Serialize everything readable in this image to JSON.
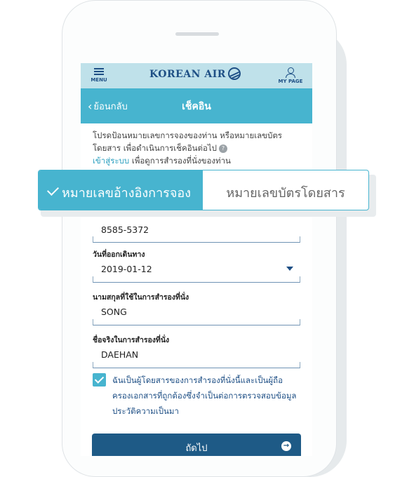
{
  "header": {
    "menu_label": "MENU",
    "logo_text": "KOREAN AIR",
    "mypage_label": "MY PAGE"
  },
  "subheader": {
    "back_label": "ย้อนกลับ",
    "title": "เช็คอิน"
  },
  "intro": {
    "line1": "โปรดป้อนหมายเลขการจองของท่าน หรือหมายเลขบัตร",
    "line2": "โดยสาร เพื่อดำเนินการเช็คอินต่อไป",
    "help_glyph": "?",
    "login_link": "เข้าสู่ระบบ",
    "login_suffix": " เพื่อดูการสำรองที่นั่งของท่าน"
  },
  "tabs": [
    {
      "label": "หมายเลขอ้างอิงการจอง",
      "selected": true
    },
    {
      "label": "หมายเลขบัตรโดยสาร",
      "selected": false
    }
  ],
  "form": {
    "booking_ref_value": "8585-5372",
    "departure_date_label": "วันที่ออกเดินทาง",
    "departure_date_value": "2019-01-12",
    "last_name_label": "นามสกุลที่ใช้ในการสำรองที่นั่ง",
    "last_name_value": "SONG",
    "first_name_label": "ชื่อจริงในการสำรองที่นั่ง",
    "first_name_value": "DAEHAN",
    "consent_line1": "ฉันเป็นผู้โดยสารของการสำรองที่นั่งนี้และเป็นผู้ถือ",
    "consent_line2": "ครองเอกสารที่ถูกต้องซึ่งจำเป็นต่อการตรวจสอบข้อมูล",
    "consent_line3": "ประวัติความเป็นมา",
    "consent_checked": true,
    "next_label": "ถัดไป"
  },
  "colors": {
    "primary_blue": "#1e4f85",
    "teal": "#47b4cf",
    "light_teal": "#bfe1ea",
    "button_blue": "#1e5a86"
  }
}
